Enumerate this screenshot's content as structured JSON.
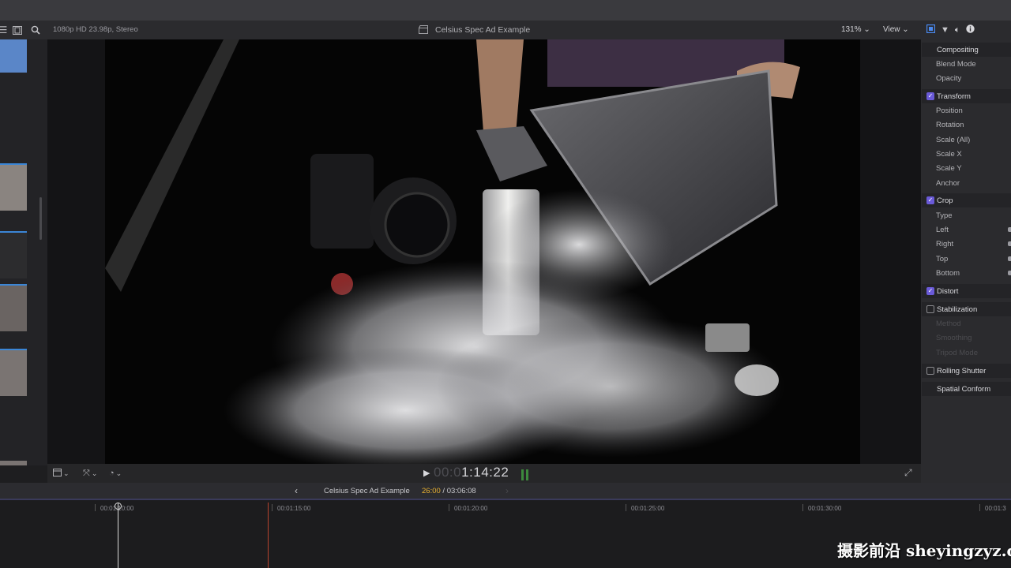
{
  "viewer": {
    "format": "1080p HD 23.98p, Stereo",
    "clip_title": "Celsius Spec Ad Example",
    "zoom": "131%",
    "view_menu": "View",
    "timecode_dim": "00:0",
    "timecode_bright": "1:14:22"
  },
  "timeline": {
    "project_name": "Celsius Spec Ad Example",
    "current_duration": "26:00",
    "separator": " / ",
    "total_duration": "03:06:08",
    "ruler": [
      "00:01:10:00",
      "00:01:15:00",
      "00:01:20:00",
      "00:01:25:00",
      "00:01:30:00",
      "00:01:3"
    ]
  },
  "inspector": {
    "rows": [
      {
        "label": "Compositing",
        "kind": "section-nochk"
      },
      {
        "label": "Blend Mode",
        "kind": "param"
      },
      {
        "label": "Opacity",
        "kind": "param"
      },
      {
        "label": "Transform",
        "kind": "section-on"
      },
      {
        "label": "Position",
        "kind": "param"
      },
      {
        "label": "Rotation",
        "kind": "param"
      },
      {
        "label": "Scale (All)",
        "kind": "param"
      },
      {
        "label": "Scale X",
        "kind": "param"
      },
      {
        "label": "Scale Y",
        "kind": "param"
      },
      {
        "label": "Anchor",
        "kind": "param"
      },
      {
        "label": "Crop",
        "kind": "section-on"
      },
      {
        "label": "Type",
        "kind": "param"
      },
      {
        "label": "Left",
        "kind": "param"
      },
      {
        "label": "Right",
        "kind": "param"
      },
      {
        "label": "Top",
        "kind": "param"
      },
      {
        "label": "Bottom",
        "kind": "param"
      },
      {
        "label": "Distort",
        "kind": "section-on"
      },
      {
        "label": "Stabilization",
        "kind": "section-off"
      },
      {
        "label": "Method",
        "kind": "dim"
      },
      {
        "label": "Smoothing",
        "kind": "dim"
      },
      {
        "label": "Tripod Mode",
        "kind": "dim"
      },
      {
        "label": "Rolling Shutter",
        "kind": "section-off"
      },
      {
        "label": "Spatial Conform",
        "kind": "section-nochk"
      }
    ]
  },
  "watermark": "摄影前沿 sheyingzyz.com",
  "colors": {
    "accent_purple": "#6a5ad8",
    "timecode_orange": "#e8b030",
    "playhead_white": "#d8d8d8",
    "skimmer_red": "#b8442e",
    "selection_blue": "#3b86d6"
  },
  "icons": [
    "grid-icon",
    "filmstrip-icon",
    "search-icon",
    "clapper-icon",
    "chevron-down-icon",
    "inspector-video-icon",
    "filter-icon",
    "audio-icon",
    "info-icon",
    "layout-icon",
    "transform-tool-icon",
    "speed-icon",
    "play-icon",
    "fullscreen-icon",
    "back-arrow-icon",
    "forward-arrow-icon",
    "checkbox-icon"
  ]
}
